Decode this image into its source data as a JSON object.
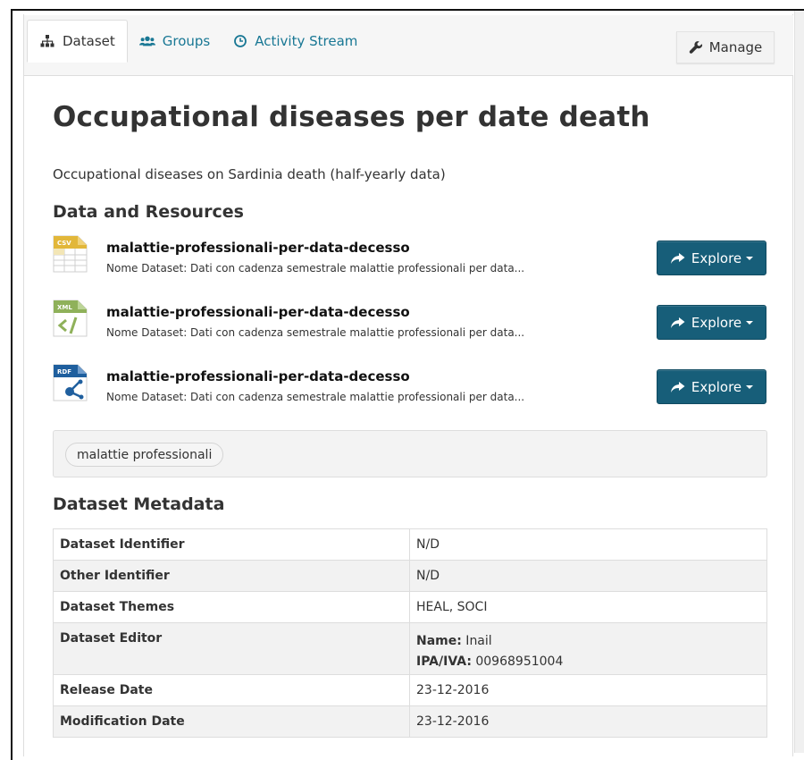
{
  "tabs": [
    {
      "label": "Dataset",
      "icon": "sitemap-icon",
      "active": true
    },
    {
      "label": "Groups",
      "icon": "users-icon",
      "active": false
    },
    {
      "label": "Activity Stream",
      "icon": "clock-icon",
      "active": false
    }
  ],
  "manage_label": "Manage",
  "title": "Occupational diseases per date death",
  "description": "Occupational diseases on Sardinia death (half-yearly data)",
  "resources_heading": "Data and Resources",
  "resources": [
    {
      "format": "CSV",
      "title": "malattie-professionali-per-data-decesso",
      "desc": "Nome Dataset: Dati con cadenza semestrale malattie professionali per data...",
      "button": "Explore"
    },
    {
      "format": "XML",
      "title": "malattie-professionali-per-data-decesso",
      "desc": "Nome Dataset: Dati con cadenza semestrale malattie professionali per data...",
      "button": "Explore"
    },
    {
      "format": "RDF",
      "title": "malattie-professionali-per-data-decesso",
      "desc": "Nome Dataset: Dati con cadenza semestrale malattie professionali per data...",
      "button": "Explore"
    }
  ],
  "tags": [
    "malattie professionali"
  ],
  "metadata_heading": "Dataset Metadata",
  "metadata": [
    {
      "key": "Dataset Identifier",
      "value": "N/D"
    },
    {
      "key": "Other Identifier",
      "value": "N/D"
    },
    {
      "key": "Dataset Themes",
      "value": "HEAL, SOCI"
    },
    {
      "key": "Dataset Editor",
      "name_label": "Name:",
      "name_value": " Inail",
      "ipa_label": "IPA/IVA:",
      "ipa_value": " 00968951004"
    },
    {
      "key": "Release Date",
      "value": "23-12-2016"
    },
    {
      "key": "Modification Date",
      "value": "23-12-2016"
    }
  ],
  "colors": {
    "link": "#187794",
    "button": "#175e79",
    "text": "#333333"
  }
}
